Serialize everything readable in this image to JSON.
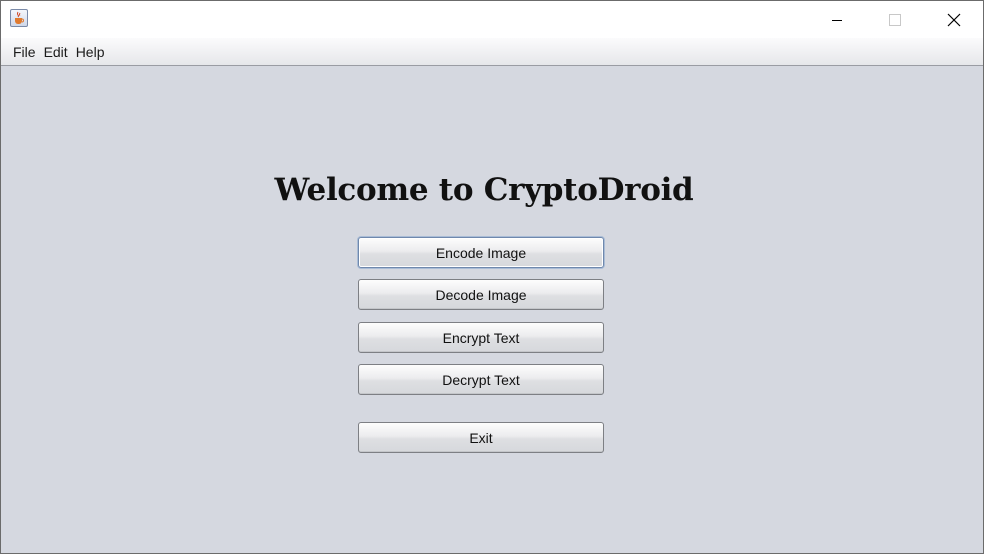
{
  "window": {
    "icon": "java-cup-icon",
    "controls": [
      "minimize-icon",
      "maximize-icon",
      "close-icon"
    ]
  },
  "menu": {
    "items": [
      "File",
      "Edit",
      "Help"
    ]
  },
  "main": {
    "title": "Welcome to CryptoDroid",
    "buttons": {
      "encode_image": "Encode Image",
      "decode_image": "Decode Image",
      "encrypt_text": "Encrypt Text",
      "decrypt_text": "Decrypt Text",
      "exit": "Exit"
    }
  },
  "colors": {
    "background": "#d5d8e0",
    "focus_border": "#6f88ad"
  }
}
